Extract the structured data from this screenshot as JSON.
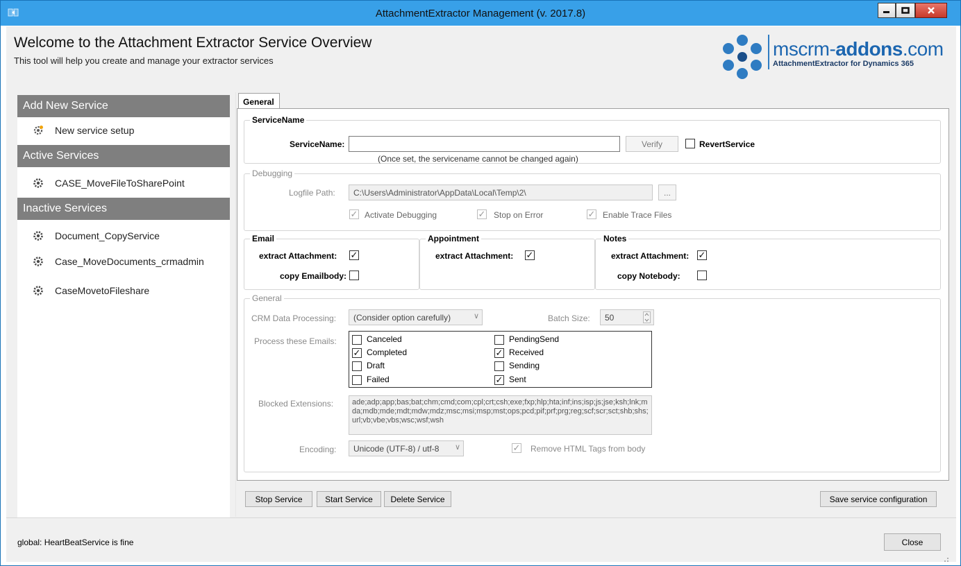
{
  "window": {
    "title": "AttachmentExtractor Management (v. 2017.8)",
    "accent_color": "#38a0e8"
  },
  "header": {
    "title": "Welcome to the Attachment Extractor Service Overview",
    "subtitle": "This tool will help you create and manage your extractor services",
    "logo_text_prefix": "mscrm-",
    "logo_text_bold": "addons",
    "logo_text_suffix": ".com",
    "logo_sub": "AttachmentExtractor for Dynamics 365"
  },
  "sidebar": {
    "add_header": "Add New Service",
    "add_items": [
      {
        "label": "New service setup",
        "icon": "gear-add-icon"
      }
    ],
    "active_header": "Active Services",
    "active_items": [
      {
        "label": "CASE_MoveFileToSharePoint",
        "icon": "gear-icon"
      }
    ],
    "inactive_header": "Inactive Services",
    "inactive_items": [
      {
        "label": "Document_CopyService",
        "icon": "gear-icon"
      },
      {
        "label": "Case_MoveDocuments_crmadmin",
        "icon": "gear-icon"
      },
      {
        "label": "CaseMovetoFileshare",
        "icon": "gear-icon"
      }
    ]
  },
  "tabs": [
    {
      "label": "General",
      "selected": true
    }
  ],
  "service_name": {
    "legend": "ServiceName",
    "label": "ServiceName:",
    "value": "",
    "hint": "(Once set, the servicename cannot be changed again)",
    "verify_label": "Verify",
    "revert_label": "RevertService",
    "revert_checked": false
  },
  "debugging": {
    "legend": "Debugging",
    "logfile_label": "Logfile Path:",
    "logfile_value": "C:\\Users\\Administrator\\AppData\\Local\\Temp\\2\\",
    "browse_label": "...",
    "activate_label": "Activate Debugging",
    "activate_checked": true,
    "stop_label": "Stop on Error",
    "stop_checked": true,
    "trace_label": "Enable Trace Files",
    "trace_checked": true
  },
  "email": {
    "legend": "Email",
    "extract_label": "extract Attachment:",
    "extract_checked": true,
    "copy_label": "copy Emailbody:",
    "copy_checked": false
  },
  "appointment": {
    "legend": "Appointment",
    "extract_label": "extract Attachment:",
    "extract_checked": true
  },
  "notes": {
    "legend": "Notes",
    "extract_label": "extract Attachment:",
    "extract_checked": true,
    "copy_label": "copy Notebody:",
    "copy_checked": false
  },
  "general": {
    "legend": "General",
    "crm_label": "CRM Data Processing:",
    "crm_value": "(Consider option carefully)",
    "batch_label": "Batch Size:",
    "batch_value": "50",
    "process_label": "Process these Emails:",
    "emails": [
      {
        "label": "Canceled",
        "checked": false
      },
      {
        "label": "Completed",
        "checked": true
      },
      {
        "label": "Draft",
        "checked": false
      },
      {
        "label": "Failed",
        "checked": false
      },
      {
        "label": "PendingSend",
        "checked": false
      },
      {
        "label": "Received",
        "checked": true
      },
      {
        "label": "Sending",
        "checked": false
      },
      {
        "label": "Sent",
        "checked": true
      }
    ],
    "blocked_label": "Blocked Extensions:",
    "blocked_value": "ade;adp;app;bas;bat;chm;cmd;com;cpl;crt;csh;exe;fxp;hlp;hta;inf;ins;isp;js;jse;ksh;lnk;mda;mdb;mde;mdt;mdw;mdz;msc;msi;msp;mst;ops;pcd;pif;prf;prg;reg;scf;scr;sct;shb;shs;url;vb;vbe;vbs;wsc;wsf;wsh",
    "encoding_label": "Encoding:",
    "encoding_value": "Unicode (UTF-8) / utf-8",
    "remove_html_label": "Remove HTML Tags from body",
    "remove_html_checked": true
  },
  "actions": {
    "stop_label": "Stop Service",
    "start_label": "Start Service",
    "delete_label": "Delete Service",
    "save_label": "Save service configuration"
  },
  "status": {
    "text": "global: HeartBeatService is fine",
    "close_label": "Close"
  }
}
